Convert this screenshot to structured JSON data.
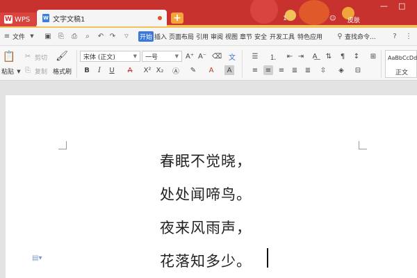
{
  "titlebar": {
    "app_tab": "WPS",
    "doc_tab": "文字文稿1",
    "new_tab": "+",
    "page_num": "1",
    "skin_label": "皮肤",
    "minimize": "—",
    "maximize": "□"
  },
  "menubar": {
    "file_menu": "文件",
    "menus": [
      "开始",
      "插入",
      "页面布局",
      "引用",
      "审阅",
      "视图",
      "章节",
      "安全",
      "开发工具",
      "特色应用"
    ],
    "search_label": "查找命令..."
  },
  "ribbon": {
    "paste": "粘贴",
    "cut": "剪切",
    "copy": "复制",
    "format_painter": "格式刷",
    "font_name": "宋体 (正文)",
    "font_size": "一号",
    "style_sample": "AaBbCcDd",
    "style_name": "正文"
  },
  "document": {
    "lines": [
      "春眠不觉晓，",
      "处处闻啼鸟。",
      "夜来风雨声，",
      "花落知多少。"
    ]
  },
  "colors": {
    "titlebar": "#c8322e",
    "accent": "#3b78d8",
    "doc_icon": "#3a7fe0"
  }
}
